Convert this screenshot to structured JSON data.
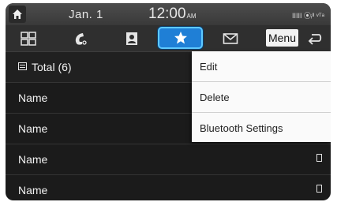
{
  "status": {
    "date": "Jan.  1",
    "time": "12:00",
    "ampm": "AM",
    "icons": "IIIII ⦿ᵢᴵᴵ ᵛᵀᵃ"
  },
  "toolbar": {
    "menu_label": "Menu",
    "buttons": [
      "grid-icon",
      "recent-calls-icon",
      "contacts-icon",
      "favorites-star-icon",
      "messages-icon",
      "back-icon"
    ]
  },
  "list": {
    "total_label": "Total (6)",
    "names": [
      "Name",
      "Name",
      "Name",
      "Name"
    ]
  },
  "menu": {
    "items": [
      "Edit",
      "Delete",
      "Bluetooth Settings"
    ]
  },
  "colors": {
    "accent": "#1f7fd6",
    "accent_border": "#5ec9ff",
    "background": "#1b1b1b"
  }
}
